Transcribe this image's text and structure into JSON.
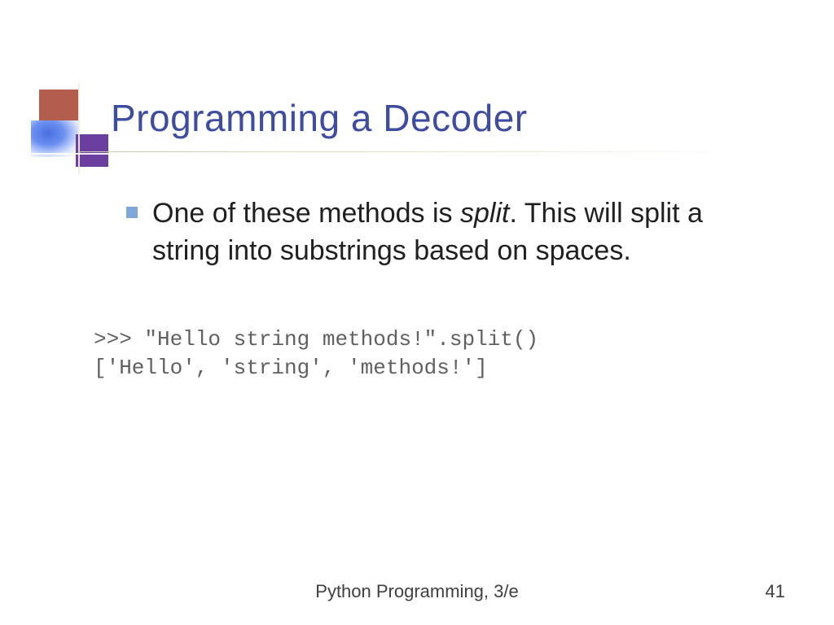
{
  "title": "Programming a Decoder",
  "bullet": {
    "pre": "One of these methods is ",
    "em": "split",
    "post": ". This will split a string into substrings based on spaces."
  },
  "code": {
    "line1": ">>> \"Hello string methods!\".split()",
    "line2": "['Hello', 'string', 'methods!']"
  },
  "footer": "Python Programming, 3/e",
  "page": "41"
}
